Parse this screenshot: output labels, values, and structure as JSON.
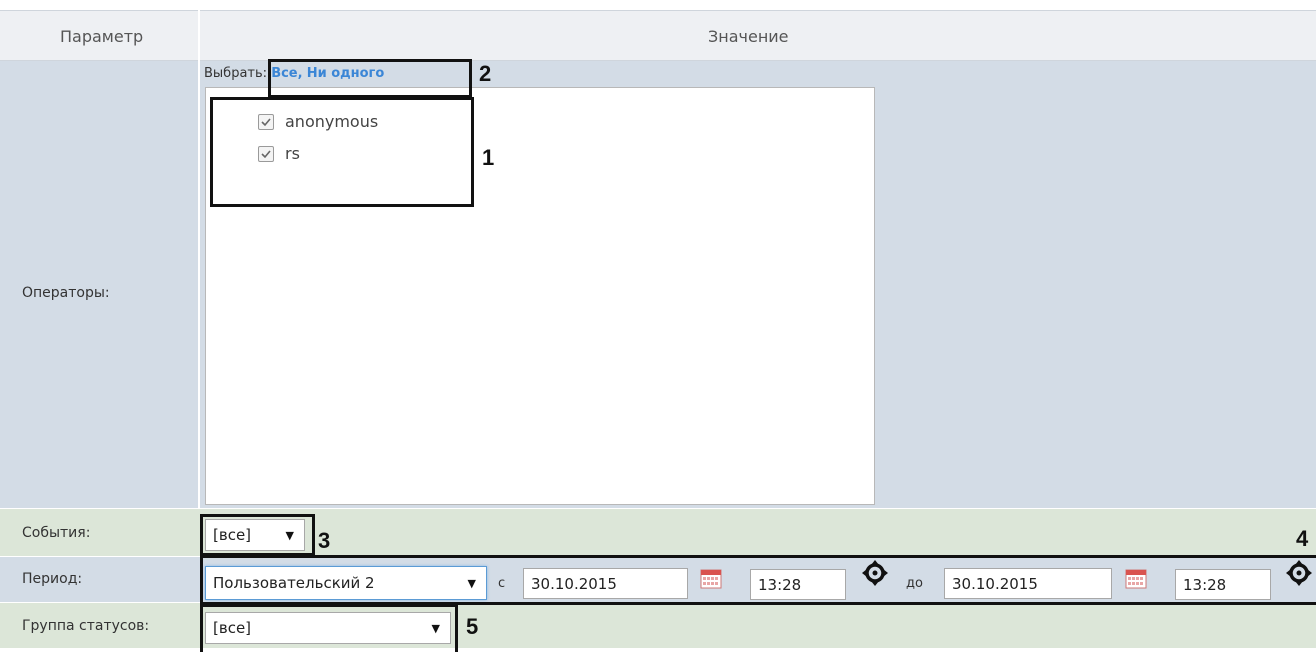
{
  "table": {
    "header": {
      "param": "Параметр",
      "value": "Значение"
    },
    "rows": {
      "operators": {
        "label": "Операторы:"
      },
      "events": {
        "label": "События:"
      },
      "period": {
        "label": "Период:"
      },
      "status_group": {
        "label": "Группа статусов:"
      }
    }
  },
  "operators": {
    "select_prefix": "Выбрать:",
    "select_all": "Все,",
    "select_none": "Ни одного",
    "items": [
      {
        "label": "anonymous",
        "checked": true
      },
      {
        "label": "rs",
        "checked": true
      }
    ]
  },
  "events": {
    "selected": "[все]"
  },
  "period": {
    "preset": "Пользовательский 2",
    "from_label": "с",
    "from_date": "30.10.2015",
    "from_time": "13:28",
    "to_label": "до",
    "to_date": "30.10.2015",
    "to_time": "13:28"
  },
  "status_group": {
    "selected": "[все]"
  },
  "annotations": [
    "1",
    "2",
    "3",
    "4",
    "5"
  ],
  "colors": {
    "header_bg": "#eef0f3",
    "row_bg": "#d3dce6",
    "events_row_bg": "#dce6d8",
    "link": "#3b86d6"
  },
  "icons": {
    "calendar": "calendar-icon",
    "time_picker": "time-picker-icon"
  }
}
